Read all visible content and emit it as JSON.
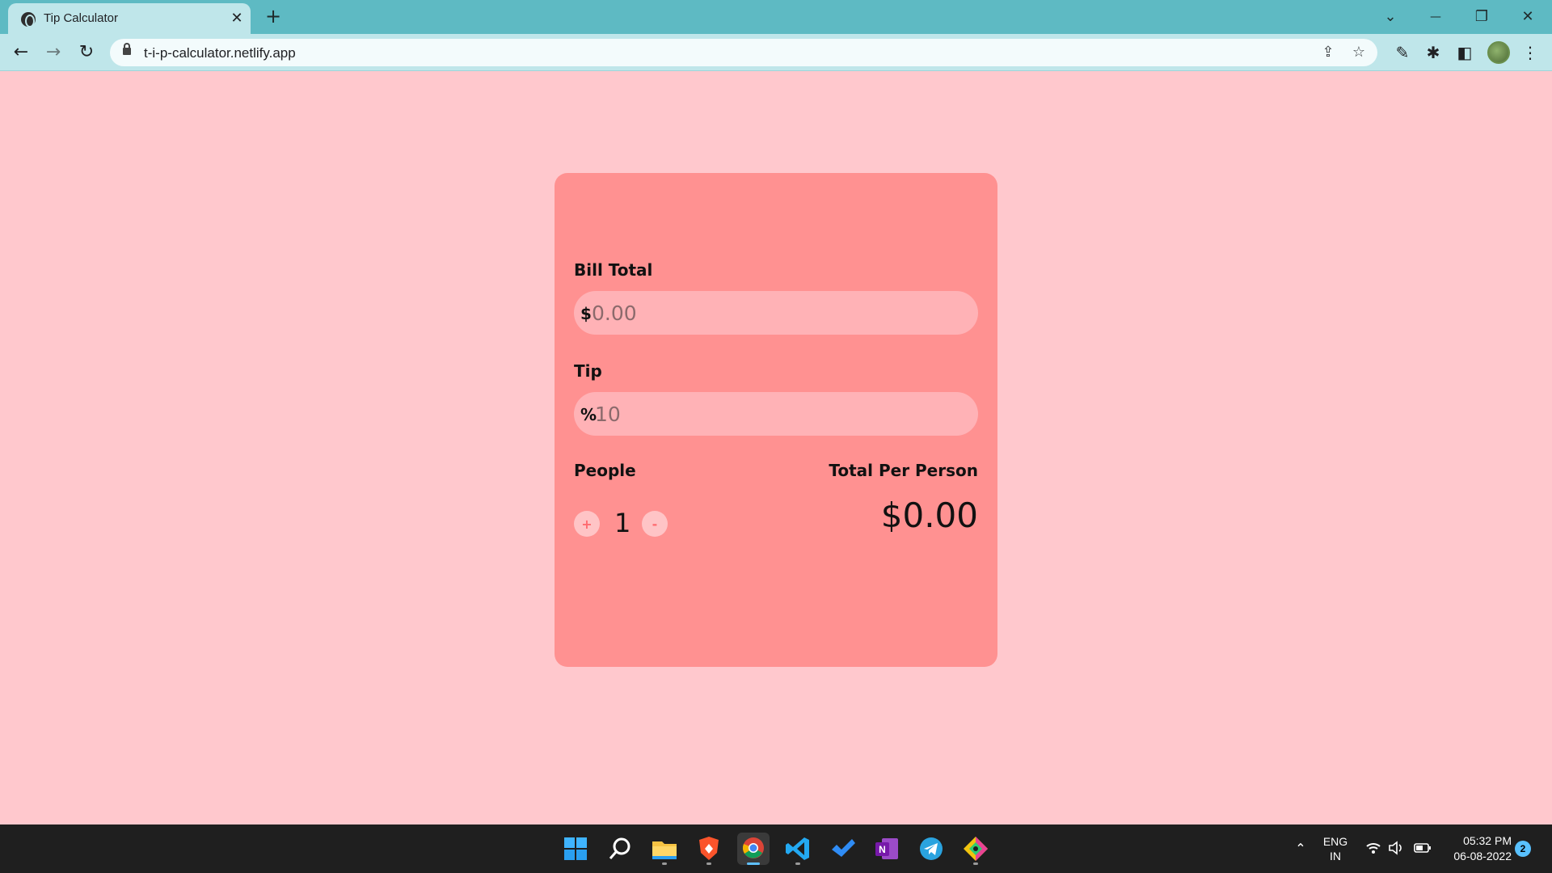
{
  "browser": {
    "tab": {
      "title": "Tip Calculator",
      "close_glyph": "✕"
    },
    "new_tab_glyph": "+",
    "url": "t-i-p-calculator.netlify.app",
    "window_controls": {
      "tab_search": "⌄",
      "minimize": "—",
      "restore": "❐",
      "close": "✕"
    },
    "nav": {
      "back": "←",
      "forward": "→",
      "reload": "↻"
    }
  },
  "page": {
    "bill": {
      "label": "Bill Total",
      "prefix": "$",
      "placeholder": "0.00"
    },
    "tip": {
      "label": "Tip",
      "prefix": "%",
      "placeholder": "10"
    },
    "people": {
      "label": "People",
      "count": "1",
      "plus_label": "+",
      "minus_label": "-"
    },
    "total_per_person": {
      "label": "Total Per Person",
      "value": "$0.00"
    }
  },
  "colors": {
    "page_background": "#ffc8cd",
    "card_background": "#ff9191",
    "input_background": "#ffb2b6",
    "browser_frame": "#5ebac3",
    "taskbar": "#1f1f1f"
  },
  "taskbar": {
    "apps": [
      "windows-start-icon",
      "search-icon",
      "file-explorer-icon",
      "brave-browser-icon",
      "chrome-icon",
      "vscode-icon",
      "todo-icon",
      "onenote-icon",
      "telegram-icon",
      "git-icon"
    ],
    "language": {
      "line1": "ENG",
      "line2": "IN"
    },
    "clock": {
      "time": "05:32 PM",
      "date": "06-08-2022"
    },
    "notification_count": "2"
  }
}
